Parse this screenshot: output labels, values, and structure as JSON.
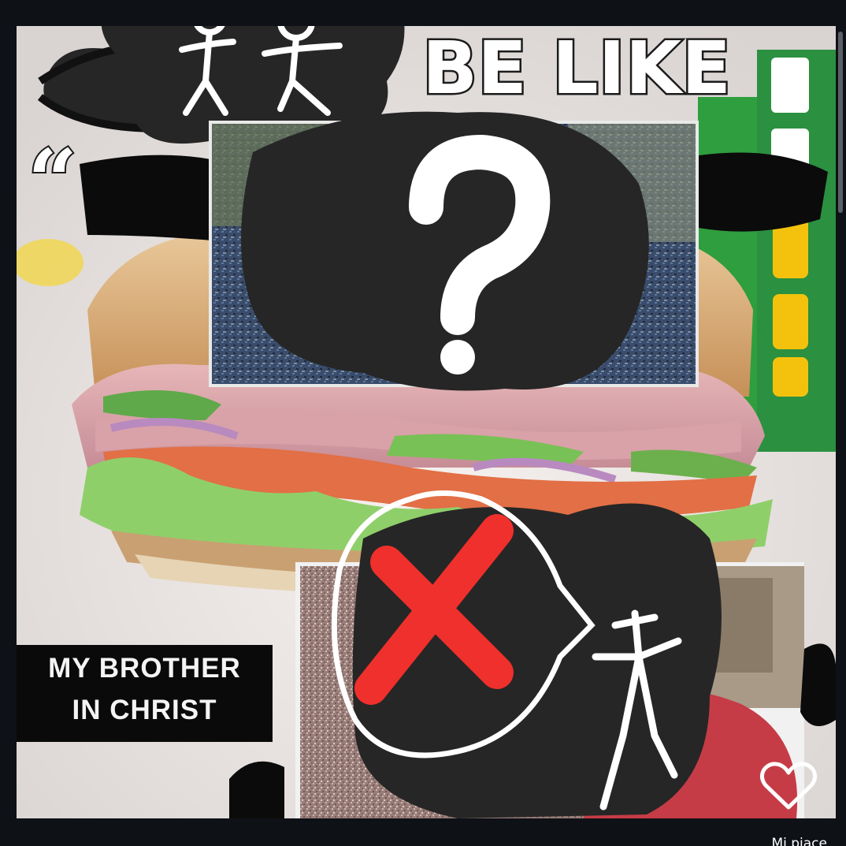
{
  "post": {
    "caption_top": "BE LIKE",
    "quote_mark": "“",
    "caption_bottom_line1": "MY BROTHER",
    "caption_bottom_line2": "IN CHRIST"
  },
  "actions": {
    "like_label": "Mi piace",
    "like_icon": "heart-outline-icon"
  },
  "colors": {
    "background": "#0e1116",
    "scribble": "#262626",
    "cross": "#f0302c",
    "subway_green": "#2f9e3e",
    "subway_yellow": "#f4c20d"
  }
}
